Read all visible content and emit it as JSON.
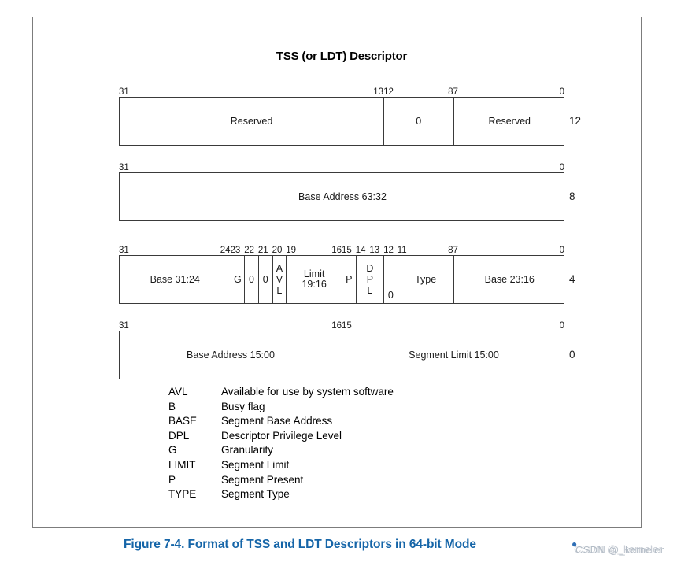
{
  "figure": {
    "title": "TSS (or LDT) Descriptor",
    "caption": "Figure 7-4.  Format of TSS and LDT Descriptors in 64-bit Mode",
    "caption_color": "#1565a8"
  },
  "watermark": {
    "text": "CSDN @_kerneler"
  },
  "rows": [
    {
      "offset": "12",
      "bit_labels": [
        {
          "text": "31",
          "bit": 31,
          "align": "left"
        },
        {
          "text": "13",
          "bit": 13,
          "align": "right"
        },
        {
          "text": "12",
          "bit": 12,
          "align": "left"
        },
        {
          "text": "8",
          "bit": 8,
          "align": "right"
        },
        {
          "text": "7",
          "bit": 7,
          "align": "left"
        },
        {
          "text": "0",
          "bit": 0,
          "align": "right"
        }
      ],
      "cells": [
        {
          "label": "Reserved",
          "bits": "31:13"
        },
        {
          "label": "0",
          "bits": "12:8"
        },
        {
          "label": "Reserved",
          "bits": "7:0"
        }
      ]
    },
    {
      "offset": "8",
      "bit_labels": [
        {
          "text": "31",
          "bit": 31,
          "align": "left"
        },
        {
          "text": "0",
          "bit": 0,
          "align": "right"
        }
      ],
      "cells": [
        {
          "label": "Base Address 63:32",
          "bits": "31:0"
        }
      ]
    },
    {
      "offset": "4",
      "bit_labels": [
        {
          "text": "31",
          "bit": 31,
          "align": "left"
        },
        {
          "text": "24",
          "bit": 24,
          "align": "right"
        },
        {
          "text": "23",
          "bit": 23,
          "align": "left"
        },
        {
          "text": "22",
          "bit": 22,
          "align": "left"
        },
        {
          "text": "21",
          "bit": 21,
          "align": "left"
        },
        {
          "text": "20",
          "bit": 20,
          "align": "left"
        },
        {
          "text": "19",
          "bit": 19,
          "align": "left"
        },
        {
          "text": "16",
          "bit": 16,
          "align": "right"
        },
        {
          "text": "15",
          "bit": 15,
          "align": "left"
        },
        {
          "text": "14",
          "bit": 14,
          "align": "left"
        },
        {
          "text": "13",
          "bit": 13,
          "align": "left"
        },
        {
          "text": "12",
          "bit": 12,
          "align": "left"
        },
        {
          "text": "11",
          "bit": 11,
          "align": "left"
        },
        {
          "text": "8",
          "bit": 8,
          "align": "right"
        },
        {
          "text": "7",
          "bit": 7,
          "align": "left"
        },
        {
          "text": "0",
          "bit": 0,
          "align": "right"
        }
      ],
      "cells": [
        {
          "label": "Base 31:24",
          "bits": "31:24"
        },
        {
          "label": "G",
          "bits": "23"
        },
        {
          "label": "0",
          "bits": "22"
        },
        {
          "label": "0",
          "bits": "21"
        },
        {
          "label": "A\nV\nL",
          "bits": "20",
          "vertical": true
        },
        {
          "label": "Limit\n19:16",
          "bits": "19:16"
        },
        {
          "label": "P",
          "bits": "15"
        },
        {
          "label": "D\nP\nL",
          "bits": "14:13",
          "vertical": true
        },
        {
          "label": "0",
          "bits": "12",
          "bottom": true
        },
        {
          "label": "Type",
          "bits": "11:8"
        },
        {
          "label": "Base 23:16",
          "bits": "7:0"
        }
      ]
    },
    {
      "offset": "0",
      "bit_labels": [
        {
          "text": "31",
          "bit": 31,
          "align": "left"
        },
        {
          "text": "16",
          "bit": 16,
          "align": "right"
        },
        {
          "text": "15",
          "bit": 15,
          "align": "left"
        },
        {
          "text": "0",
          "bit": 0,
          "align": "right"
        }
      ],
      "cells": [
        {
          "label": "Base Address 15:00",
          "bits": "31:16"
        },
        {
          "label": "Segment Limit 15:00",
          "bits": "15:0"
        }
      ]
    }
  ],
  "legend": [
    {
      "term": "AVL",
      "desc": "Available for use by system software"
    },
    {
      "term": "B",
      "desc": "Busy flag"
    },
    {
      "term": "BASE",
      "desc": "Segment Base Address"
    },
    {
      "term": "DPL",
      "desc": "Descriptor Privilege Level"
    },
    {
      "term": "G",
      "desc": "Granularity"
    },
    {
      "term": "LIMIT",
      "desc": "Segment Limit"
    },
    {
      "term": "P",
      "desc": "Segment Present"
    },
    {
      "term": "TYPE",
      "desc": "Segment Type"
    }
  ]
}
